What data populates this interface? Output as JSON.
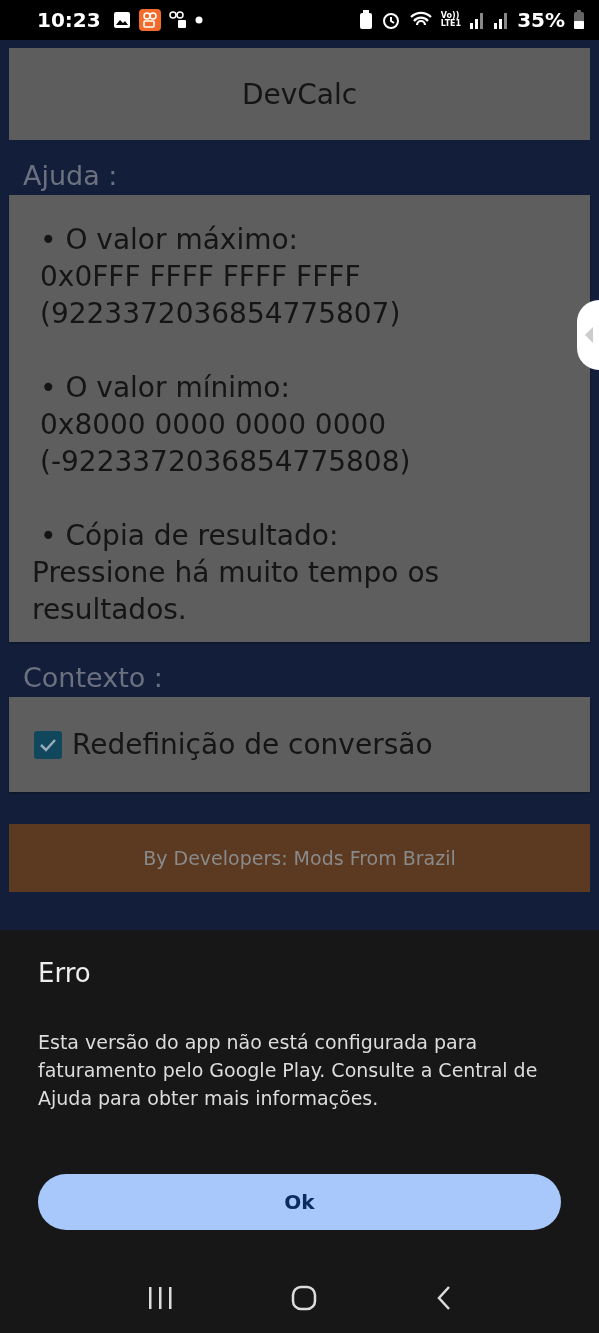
{
  "status_bar": {
    "time": "10:23",
    "network_label": "Vo))\nLTE1",
    "battery": "35%"
  },
  "app": {
    "title": "DevCalc",
    "help": {
      "label": "Ajuda :",
      "items": [
        {
          "bullet": "•",
          "heading": "O valor máximo:",
          "lines": [
            "0x0FFF FFFF FFFF FFFF",
            "(9223372036854775807)"
          ]
        },
        {
          "bullet": "•",
          "heading": "O valor mínimo:",
          "lines": [
            "0x8000 0000 0000 0000",
            "(-9223372036854775808)"
          ]
        },
        {
          "bullet": "•",
          "heading": "Cópia de resultado:",
          "lines": [
            "Pressione há muito tempo os resultados."
          ]
        }
      ]
    },
    "context": {
      "label": "Contexto :",
      "options": [
        {
          "label": "Redefinição de conversão",
          "checked": true
        }
      ]
    },
    "footer": "By Developers: Mods From Brazil"
  },
  "dialog": {
    "title": "Erro",
    "message": "Esta versão do app não está configurada para faturamento pelo Google Play. Consulte a Central de Ajuda para obter mais informações.",
    "button": "Ok"
  }
}
